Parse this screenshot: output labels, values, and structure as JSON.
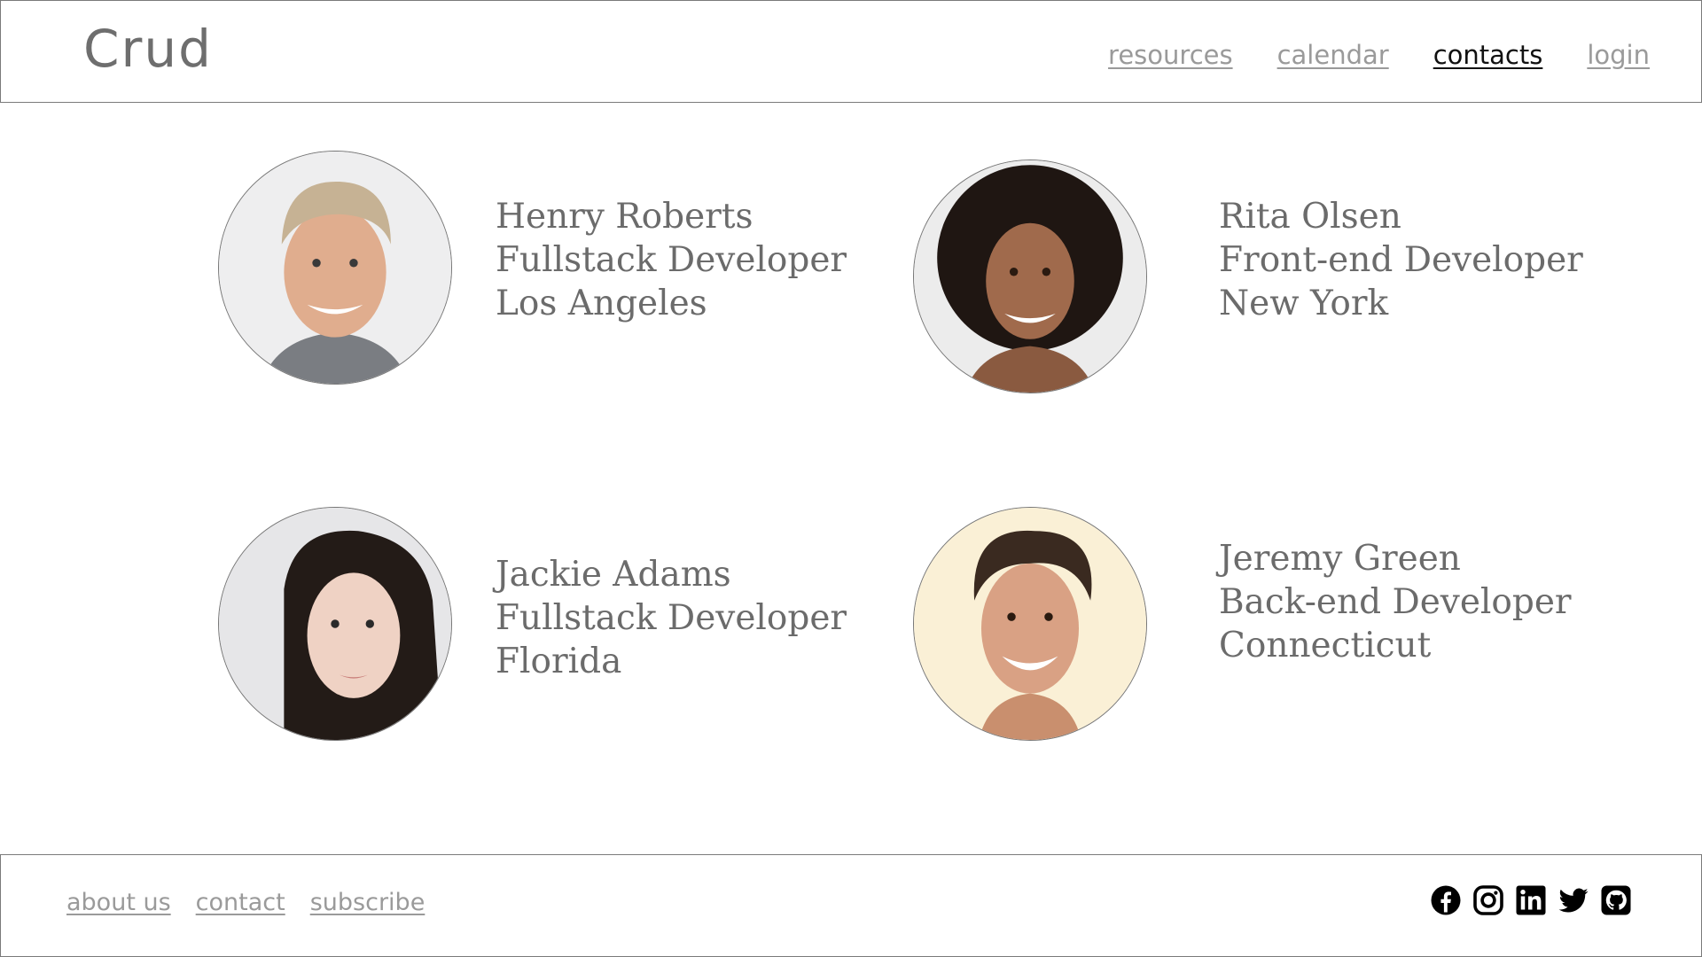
{
  "header": {
    "brand": "Crud",
    "nav": [
      {
        "label": "resources",
        "active": false
      },
      {
        "label": "calendar",
        "active": false
      },
      {
        "label": "contacts",
        "active": true
      },
      {
        "label": "login",
        "active": false
      }
    ]
  },
  "contacts": [
    {
      "name": "Henry Roberts",
      "role": "Fullstack Developer",
      "location": "Los Angeles"
    },
    {
      "name": "Rita Olsen",
      "role": "Front-end Developer",
      "location": "New York"
    },
    {
      "name": "Jackie Adams",
      "role": "Fullstack Developer",
      "location": "Florida"
    },
    {
      "name": "Jeremy Green",
      "role": "Back-end Developer",
      "location": "Connecticut"
    }
  ],
  "footer": {
    "links": [
      "about us",
      "contact",
      "subscribe"
    ],
    "social_icons": [
      "facebook-icon",
      "instagram-icon",
      "linkedin-icon",
      "twitter-icon",
      "github-icon"
    ]
  }
}
